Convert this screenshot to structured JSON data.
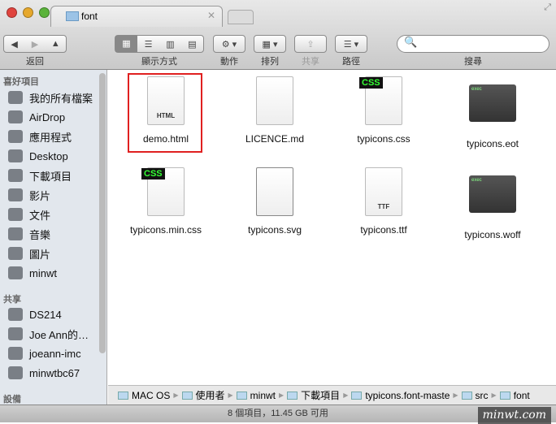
{
  "window": {
    "tab_title": "font"
  },
  "toolbar": {
    "back_label": "返回",
    "view_label": "顯示方式",
    "action_label": "動作",
    "arrange_label": "排列",
    "share_label": "共享",
    "path_label": "路徑",
    "search_label": "搜尋",
    "search_value": ""
  },
  "sidebar": {
    "favorites_header": "喜好項目",
    "favorites": [
      {
        "label": "我的所有檔案"
      },
      {
        "label": "AirDrop"
      },
      {
        "label": "應用程式"
      },
      {
        "label": "Desktop"
      },
      {
        "label": "下載項目"
      },
      {
        "label": "影片"
      },
      {
        "label": "文件"
      },
      {
        "label": "音樂"
      },
      {
        "label": "圖片"
      },
      {
        "label": "minwt"
      }
    ],
    "shared_header": "共享",
    "shared": [
      {
        "label": "DS214"
      },
      {
        "label": "Joe Ann的…"
      },
      {
        "label": "joeann-imc"
      },
      {
        "label": "minwtbc67"
      }
    ],
    "devices_header": "設備"
  },
  "files": [
    {
      "name": "demo.html",
      "type": "html",
      "badge": "HTML",
      "selected": true
    },
    {
      "name": "LICENCE.md",
      "type": "doc",
      "badge": ""
    },
    {
      "name": "typicons.css",
      "type": "css",
      "badge": "CSS"
    },
    {
      "name": "typicons.eot",
      "type": "exec",
      "badge": "exec"
    },
    {
      "name": "typicons.min.css",
      "type": "css",
      "badge": "CSS"
    },
    {
      "name": "typicons.svg",
      "type": "svg",
      "badge": ""
    },
    {
      "name": "typicons.ttf",
      "type": "ttf",
      "badge": "TTF"
    },
    {
      "name": "typicons.woff",
      "type": "exec",
      "badge": "exec"
    }
  ],
  "pathbar": [
    "MAC OS",
    "使用者",
    "minwt",
    "下載項目",
    "typicons.font-maste",
    "src",
    "font"
  ],
  "status": {
    "text": "8 個項目，11.45 GB 可用",
    "watermark": "minwt.com"
  },
  "colors": {
    "selection": "#e02020",
    "sidebar_bg": "#e2e7ed"
  }
}
